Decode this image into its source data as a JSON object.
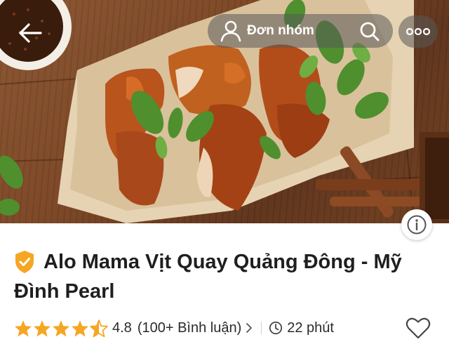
{
  "header": {
    "back_icon": "arrow-left-icon",
    "group_order_label": "Đơn nhóm",
    "group_icon": "person-icon",
    "search_icon": "search-icon",
    "more_icon": "more-horizontal-icon"
  },
  "hero": {
    "image": "roast duck with herbs on parchment paper",
    "info_icon": "info-icon"
  },
  "restaurant": {
    "verified_icon": "shield-check-icon",
    "name": "Alo Mama Vịt Quay Quảng Đông - Mỹ Đình Pearl",
    "rating": "4.8",
    "rating_value": 4.5,
    "rating_max": 5,
    "reviews": "(100+ Bình luận)",
    "delivery_time": "22 phút",
    "clock_icon": "clock-icon",
    "favorite_icon": "heart-icon"
  },
  "colors": {
    "accent": "#f5a623",
    "text": "#1f1f1f"
  }
}
